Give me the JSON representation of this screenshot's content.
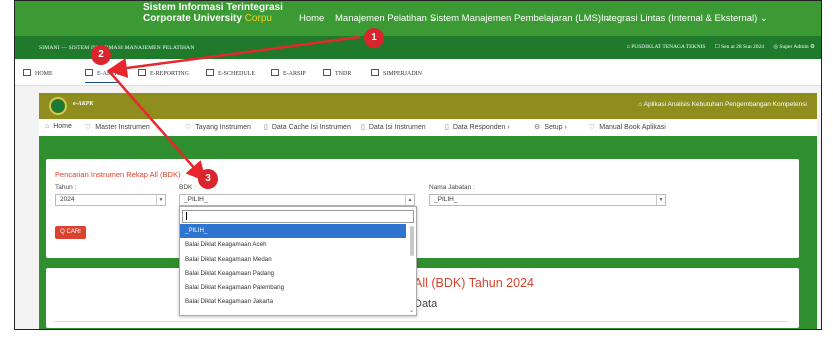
{
  "topbar": {
    "brand_line1": "Sistem Informasi Terintegrasi",
    "brand_line2": "Corporate University",
    "brand_tag": "Corpu",
    "menu": [
      {
        "label": "Home"
      },
      {
        "label": "Manajemen Pelatihan ⌄"
      },
      {
        "label": "Sistem Manajemen Pembelajaran (LMS) ⌄"
      },
      {
        "label": "Integrasi Lintas (Internal & Eksternal) ⌄"
      }
    ]
  },
  "subbar": {
    "left": "SIMANI — SISTEM INFORMASI MANAJEMEN PELATIHAN",
    "org": "⌂ PUSDIKLAT TENAGA TEKNIS",
    "date": "☐ Sen at 28 Sun 2024",
    "user": "◎ Super Admin ⚙"
  },
  "module_tabs": [
    {
      "label": "HOME"
    },
    {
      "label": "E-AKPK"
    },
    {
      "label": "E-REPORTING"
    },
    {
      "label": "E-SCHEDULE"
    },
    {
      "label": "E-ARSIP"
    },
    {
      "label": "TNDR"
    },
    {
      "label": "SIMPERJADIN"
    }
  ],
  "app_header": {
    "title": "e-AKPK",
    "right": "⌂ Aplikasi Analisis Kebutuhan Pengembangan Kompetensi"
  },
  "nav": [
    {
      "label": "Home",
      "icon": "⌂"
    },
    {
      "label": "Master Instrumen",
      "icon": "♡"
    },
    {
      "label": "Tayang Instrumen",
      "icon": "♡"
    },
    {
      "label": "Data Cache Isi Instrumen",
      "icon": "▯"
    },
    {
      "label": "Data Isi Instrumen",
      "icon": "▯"
    },
    {
      "label": "Data Responden ›",
      "icon": "▯"
    },
    {
      "label": "Setup ›",
      "icon": "⚙"
    },
    {
      "label": "Manual Book Aplikasi",
      "icon": "♡"
    }
  ],
  "search_card": {
    "title": "Pencarian Instrumen Rekap All (BDK)",
    "tahun_label": "Tahun :",
    "tahun_value": "2024",
    "bdk_label": "BDK :",
    "bdk_value": "_PILIH_",
    "jabatan_label": "Nama Jabatan :",
    "jabatan_value": "_PILIH_",
    "cari_label": "Q CARI"
  },
  "result_card": {
    "heading": "All (BDK) Tahun 2024",
    "subheading": "Data"
  },
  "dropdown": {
    "options": [
      "_PILIH_",
      "Balai Diklat Keagamaan Aceh",
      "Balai Diklat Keagamaan Medan",
      "Balai Diklat Keagamaan Padang",
      "Balai Diklat Keagamaan Palembang",
      "Balai Diklat Keagamaan Jakarta"
    ],
    "selected_index": 0
  },
  "annotations": [
    {
      "label": "1"
    },
    {
      "label": "2"
    },
    {
      "label": "3"
    }
  ],
  "colors": {
    "topbar": "#3b9a33",
    "subbar": "#1f7a2c",
    "app_header": "#8e8d1e",
    "content": "#2f8f2f",
    "accent_red": "#d9432e",
    "selected_blue": "#2f74cf",
    "annotation_red": "#d8262c"
  }
}
